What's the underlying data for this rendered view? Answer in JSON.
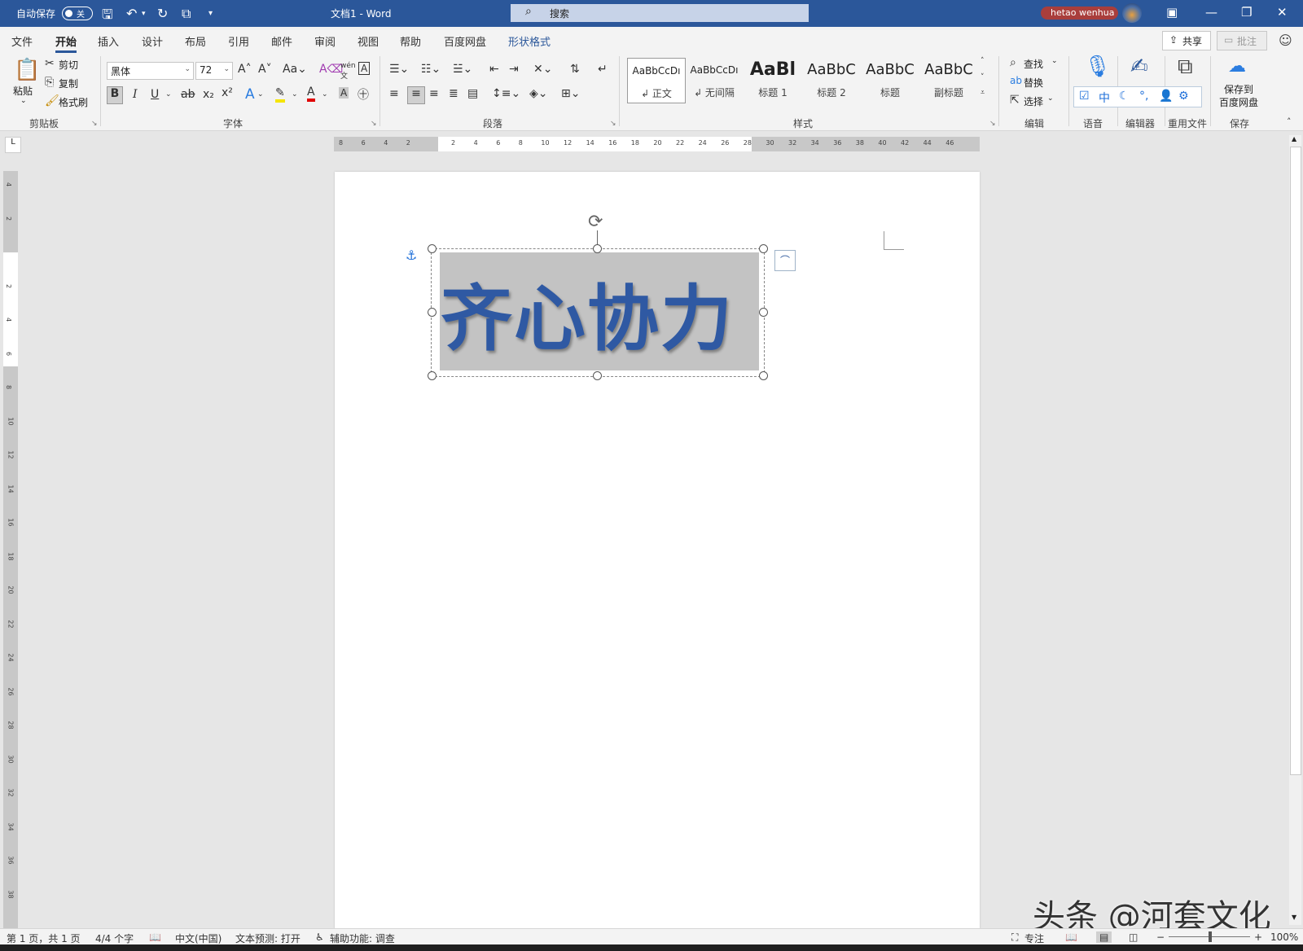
{
  "titlebar": {
    "autosave_label": "自动保存",
    "autosave_state": "关",
    "doc_title": "文档1  -  Word",
    "search_placeholder": "搜索",
    "user_name": "hetao wenhua"
  },
  "tabs": [
    "文件",
    "开始",
    "插入",
    "设计",
    "布局",
    "引用",
    "邮件",
    "审阅",
    "视图",
    "帮助",
    "百度网盘",
    "形状格式"
  ],
  "active_tab": "开始",
  "share_label": "共享",
  "comment_label": "批注",
  "clipboard": {
    "paste": "粘贴",
    "cut": "剪切",
    "copy": "复制",
    "format_painter": "格式刷",
    "group": "剪贴板"
  },
  "font": {
    "name": "黑体",
    "size": "72",
    "group": "字体"
  },
  "paragraph": {
    "group": "段落"
  },
  "styles": {
    "items": [
      {
        "preview": "AaBbCcDı",
        "name": "↲ 正文"
      },
      {
        "preview": "AaBbCcDı",
        "name": "↲ 无间隔"
      },
      {
        "preview": "AaBl",
        "name": "标题 1"
      },
      {
        "preview": "AaBbC",
        "name": "标题 2"
      },
      {
        "preview": "AaBbC",
        "name": "标题"
      },
      {
        "preview": "AaBbC",
        "name": "副标题"
      }
    ],
    "group": "样式"
  },
  "editing": {
    "find": "查找",
    "replace": "替换",
    "select": "选择",
    "group": "编辑"
  },
  "voice_group": "语音",
  "editor_group": "编辑器",
  "reuse_group": "重用文件",
  "baidu": {
    "label_line1": "保存到",
    "label_line2": "百度网盘",
    "group": "保存"
  },
  "ime_char": "中",
  "ruler_h": [
    "8",
    "6",
    "4",
    "2",
    "",
    "2",
    "4",
    "6",
    "8",
    "10",
    "12",
    "14",
    "16",
    "18",
    "20",
    "22",
    "24",
    "26",
    "28",
    "30",
    "32",
    "34",
    "36",
    "38",
    "40",
    "42",
    "44",
    "46"
  ],
  "ruler_v": [
    "4",
    "2",
    "",
    "2",
    "4",
    "6",
    "8",
    "10",
    "12",
    "14",
    "16",
    "18",
    "20",
    "22",
    "24",
    "26",
    "28",
    "30",
    "32",
    "34",
    "36",
    "38"
  ],
  "document": {
    "shape_text": "齐心协力"
  },
  "status": {
    "page": "第 1 页，共 1 页",
    "words": "4/4 个字",
    "lang": "中文(中国)",
    "predict": "文本预测: 打开",
    "access": "辅助功能: 调查",
    "focus": "专注",
    "zoom": "100%"
  },
  "watermark": "头条 @河套文化",
  "colors": {
    "accent": "#2b579a",
    "shape_text": "#2f59a3",
    "shape_fill": "#c3c3c3"
  }
}
